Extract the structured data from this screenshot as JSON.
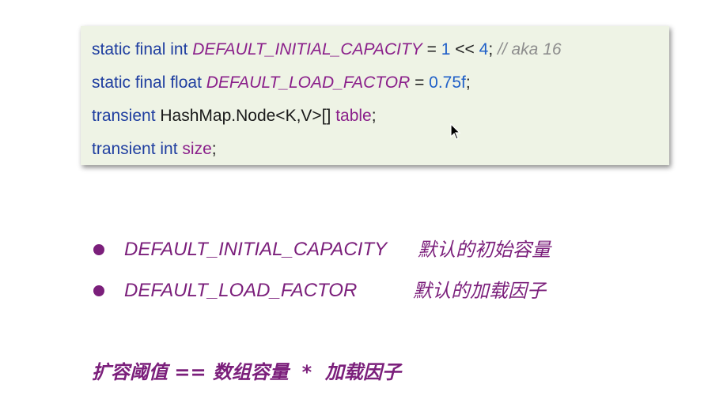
{
  "code": {
    "line1": {
      "modifiers": "static final int ",
      "const_name": "DEFAULT_INITIAL_CAPACITY",
      "op": " = ",
      "num1": "1",
      "shift": " << ",
      "num2": "4",
      "semi": "; ",
      "comment": "// aka 16"
    },
    "line2": {
      "modifiers": "static final float ",
      "const_name": "DEFAULT_LOAD_FACTOR",
      "op": " = ",
      "value": "0.75f",
      "semi": ";"
    },
    "line3": {
      "modifier": "transient ",
      "type": "HashMap.Node<K,V>[] ",
      "field": "table",
      "semi": ";"
    },
    "line4": {
      "modifiers": "transient int ",
      "field": "size",
      "semi": ";"
    }
  },
  "bullets": [
    {
      "name": "DEFAULT_INITIAL_CAPACITY",
      "desc": "默认的初始容量"
    },
    {
      "name": "DEFAULT_LOAD_FACTOR",
      "desc": "默认的加载因子"
    }
  ],
  "formula": "扩容阈值 == 数组容量  *  加载因子",
  "colors": {
    "accent": "#7b1f7b",
    "keyword": "#1f3ea0",
    "number": "#1f5fc8",
    "comment": "#8d8d8d",
    "code_bg": "#eef3e5"
  },
  "icons": {
    "cursor": "mouse-pointer-icon",
    "bullet": "bullet-dot-icon"
  }
}
